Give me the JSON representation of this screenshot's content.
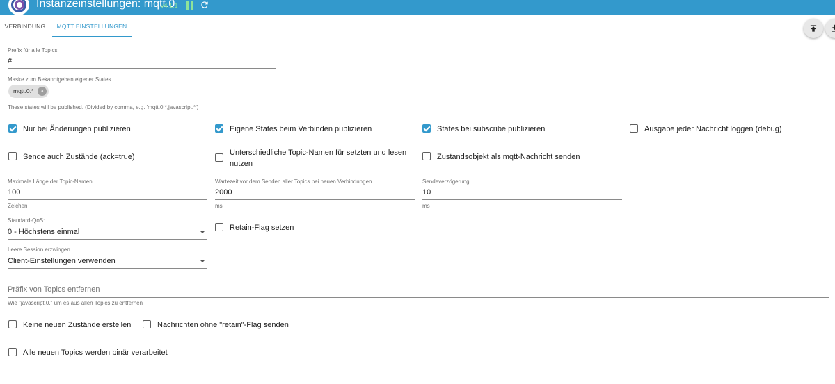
{
  "header": {
    "title": "Instanzeinstellungen: mqtt.0",
    "version": "v4.1.1",
    "colors": {
      "bar": "#3399cc",
      "status": "#8ee39a"
    },
    "icons": {
      "logo": "iobroker-logo",
      "pause": "pause-icon",
      "reload": "reload-icon"
    }
  },
  "tabs": [
    {
      "label": "VERBINDUNG",
      "active": false
    },
    {
      "label": "MQTT EINSTELLUNGEN",
      "active": true
    }
  ],
  "actions": {
    "upload_icon": "upload-icon",
    "download_icon": "download-icon"
  },
  "prefix": {
    "label": "Prefix für alle Topics",
    "value": "#"
  },
  "mask": {
    "label": "Maske zum Bekanntgeben eigener States",
    "chip": "mqtt.0.*",
    "helper": "These states will be published. (Divided by comma, e.g. 'mqtt.0.*,javascript.*')"
  },
  "checks_row1": [
    {
      "label": "Nur bei Änderungen publizieren",
      "checked": true
    },
    {
      "label": "Eigene States beim Verbinden publizieren",
      "checked": true
    },
    {
      "label": "States bei subscribe publizieren",
      "checked": true
    },
    {
      "label": "Ausgabe jeder Nachricht loggen (debug)",
      "checked": false
    }
  ],
  "checks_row2": [
    {
      "label": "Sende auch Zustände (ack=true)",
      "checked": false
    },
    {
      "label": "Unterschiedliche Topic-Namen für setzten und lesen",
      "label2": "nutzen",
      "checked": false
    },
    {
      "label": "Zustandsobjekt als mqtt-Nachricht senden",
      "checked": false
    }
  ],
  "maxlen": {
    "label": "Maximale Länge der Topic-Namen",
    "value": "100",
    "helper": "Zeichen"
  },
  "waittime": {
    "label": "Wartezeit vor dem Senden aller Topics bei neuen Verbindungen",
    "value": "2000",
    "helper": "ms"
  },
  "senddelay": {
    "label": "Sendeverzögerung",
    "value": "10",
    "helper": "ms"
  },
  "qos": {
    "label": "Standard-QoS:",
    "value": "0 - Höchstens einmal"
  },
  "retain": {
    "label": "Retain-Flag setzen",
    "checked": false
  },
  "session": {
    "label": "Leere Session erzwingen",
    "value": "Client-Einstellungen verwenden"
  },
  "remove_prefix": {
    "placeholder": "Präfix von Topics entfernen",
    "helper": "Wie \"javascript.0.\" um es aus allen Topics zu entfernen"
  },
  "checks_bottom": [
    {
      "label": "Keine neuen Zustände erstellen",
      "checked": false
    },
    {
      "label": "Nachrichten ohne \"retain\"-Flag senden",
      "checked": false
    },
    {
      "label": "Alle neuen Topics werden binär verarbeitet",
      "checked": false
    }
  ]
}
